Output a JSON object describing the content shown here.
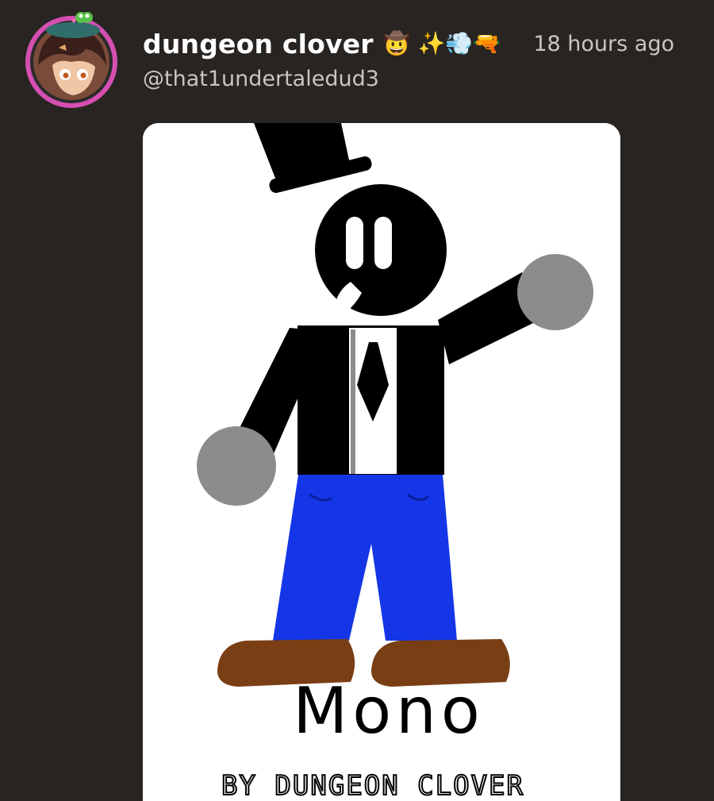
{
  "post": {
    "author": {
      "display_name": "dungeon clover",
      "name_emojis": "🤠 ✨💨🔫",
      "handle": "@that1undertaledud3",
      "avatar_ring_color": "#d44fb1"
    },
    "timestamp": "18 hours ago",
    "image": {
      "title": "Mono",
      "credit": "BY DUNGEON CLOVER",
      "colors": {
        "pants": "#1436e6",
        "shoes": "#7a3e15",
        "hands": "#8c8c8c",
        "body": "#000000"
      }
    }
  },
  "icons": {
    "avatar": "user-avatar-icon"
  }
}
